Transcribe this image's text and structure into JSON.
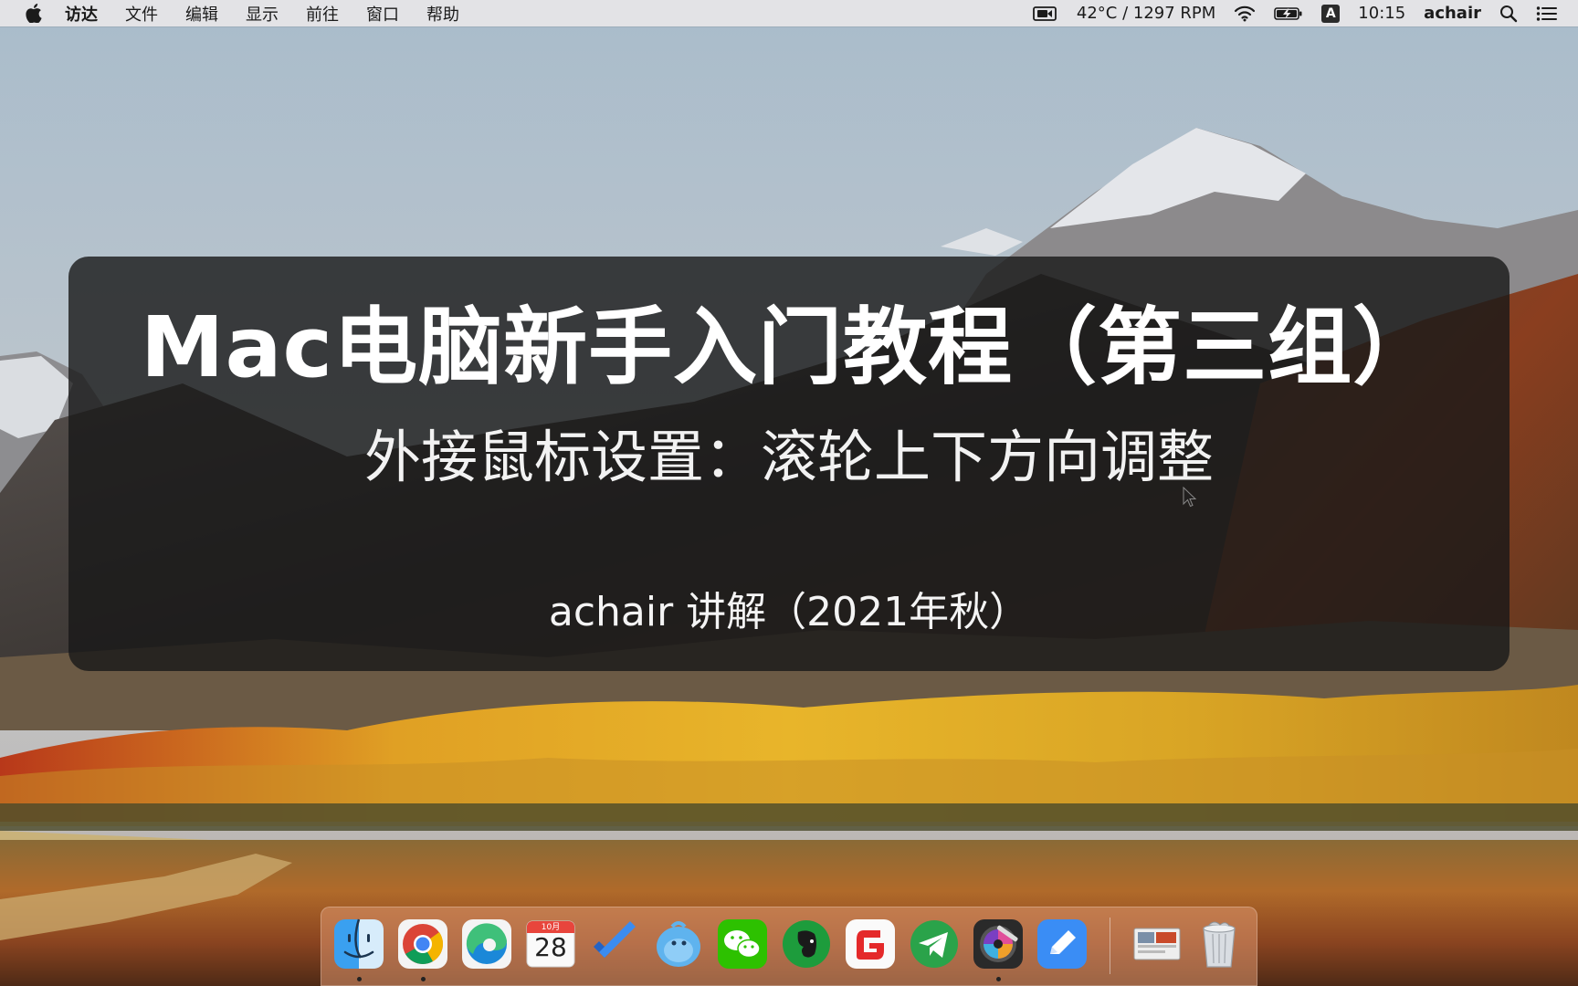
{
  "menubar": {
    "app_menu": "访达",
    "menus": [
      "文件",
      "编辑",
      "显示",
      "前往",
      "窗口",
      "帮助"
    ],
    "status": {
      "temperature": "42°C / 1297 RPM",
      "input_method": "A",
      "clock": "10:15",
      "user": "achair"
    }
  },
  "overlay": {
    "title": "Mac电脑新手入门教程（第三组）",
    "subtitle": "外接鼠标设置：滚轮上下方向调整",
    "presenter": "achair 讲解（2021年秋）"
  },
  "dock": {
    "calendar": {
      "month": "10月",
      "day": "28"
    },
    "apps": [
      {
        "name": "finder",
        "running": true
      },
      {
        "name": "chrome",
        "running": true
      },
      {
        "name": "edge",
        "running": false
      },
      {
        "name": "calendar",
        "running": false
      },
      {
        "name": "todo",
        "running": false
      },
      {
        "name": "qq-bird",
        "running": false
      },
      {
        "name": "wechat",
        "running": false
      },
      {
        "name": "evernote",
        "running": false
      },
      {
        "name": "foxit-reader",
        "running": false
      },
      {
        "name": "telegram",
        "running": false
      },
      {
        "name": "final-cut",
        "running": true
      },
      {
        "name": "pen-app",
        "running": false
      },
      {
        "name": "screenshot-preview",
        "running": false
      },
      {
        "name": "trash",
        "running": false
      }
    ]
  },
  "colors": {
    "menubar_bg": "#e8e6e8",
    "overlay_bg": "#181818",
    "dock_tint": "#dc966e"
  }
}
